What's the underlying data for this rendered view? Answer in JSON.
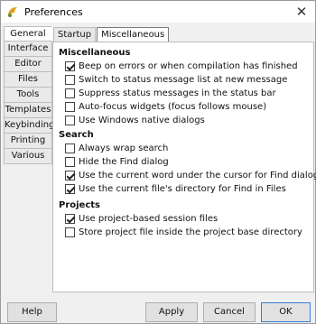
{
  "window": {
    "title": "Preferences"
  },
  "sidebar": {
    "items": [
      {
        "label": "General",
        "active": true
      },
      {
        "label": "Interface"
      },
      {
        "label": "Editor"
      },
      {
        "label": "Files"
      },
      {
        "label": "Tools"
      },
      {
        "label": "Templates"
      },
      {
        "label": "Keybindings"
      },
      {
        "label": "Printing"
      },
      {
        "label": "Various"
      }
    ]
  },
  "tabs": [
    {
      "label": "Startup"
    },
    {
      "label": "Miscellaneous",
      "active": true
    }
  ],
  "sections": {
    "misc": {
      "title": "Miscellaneous",
      "options": [
        {
          "label": "Beep on errors or when compilation has finished",
          "checked": true
        },
        {
          "label": "Switch to status message list at new message",
          "checked": false
        },
        {
          "label": "Suppress status messages in the status bar",
          "checked": false
        },
        {
          "label": "Auto-focus widgets (focus follows mouse)",
          "checked": false
        },
        {
          "label": "Use Windows native dialogs",
          "checked": false
        }
      ]
    },
    "search": {
      "title": "Search",
      "options": [
        {
          "label": "Always wrap search",
          "checked": false
        },
        {
          "label": "Hide the Find dialog",
          "checked": false
        },
        {
          "label": "Use the current word under the cursor for Find dialogs",
          "checked": true
        },
        {
          "label": "Use the current file's directory for Find in Files",
          "checked": true
        }
      ]
    },
    "projects": {
      "title": "Projects",
      "options": [
        {
          "label": "Use project-based session files",
          "checked": true
        },
        {
          "label": "Store project file inside the project base directory",
          "checked": false
        }
      ]
    }
  },
  "buttons": {
    "help": "Help",
    "apply": "Apply",
    "cancel": "Cancel",
    "ok": "OK"
  }
}
